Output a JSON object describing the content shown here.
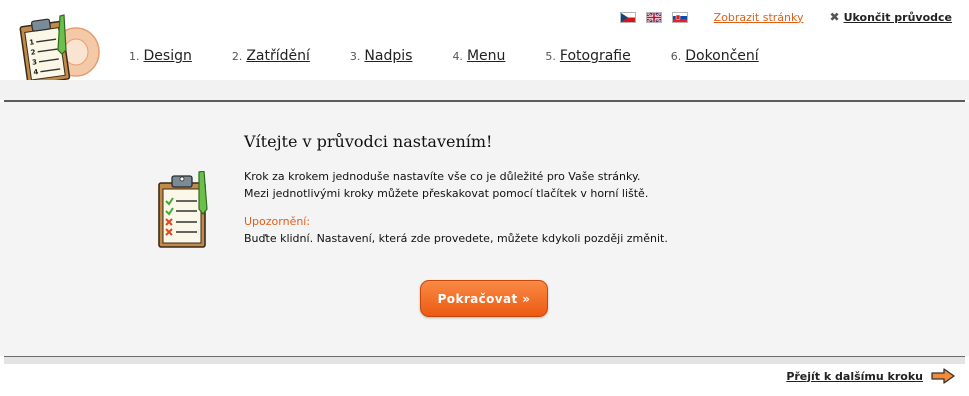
{
  "header": {
    "languages": [
      {
        "code": "cs",
        "icon": "czech-flag-icon"
      },
      {
        "code": "en",
        "icon": "uk-flag-icon"
      },
      {
        "code": "sk",
        "icon": "slovak-flag-icon"
      }
    ],
    "show_pages_label": "Zobrazit stránky",
    "exit_icon": "close-icon",
    "exit_label": "Ukončit průvodce",
    "steps": [
      {
        "num": "1.",
        "label": "Design"
      },
      {
        "num": "2.",
        "label": "Zatřídění"
      },
      {
        "num": "3.",
        "label": "Nadpis"
      },
      {
        "num": "4.",
        "label": "Menu"
      },
      {
        "num": "5.",
        "label": "Fotografie"
      },
      {
        "num": "6.",
        "label": "Dokončení"
      }
    ]
  },
  "main": {
    "title": "Vítejte v průvodci nastavením!",
    "intro_line1": "Krok za krokem jednoduše nastavíte vše co je důležité pro Vaše stránky.",
    "intro_line2": "Mezi jednotlivými kroky můžete přeskakovat pomocí tlačítek v horní liště.",
    "warning_title": "Upozornění:",
    "warning_text": "Buďte klidní. Nastavení, která zde provedete, můžete kdykoli později změnit.",
    "continue_label": "Pokračovat »"
  },
  "footer": {
    "next_label": "Přejít k dalšímu kroku",
    "next_icon": "arrow-right-icon"
  },
  "colors": {
    "accent": "#e06018",
    "button": "#f26c22",
    "panel": "#f4f4f4"
  }
}
